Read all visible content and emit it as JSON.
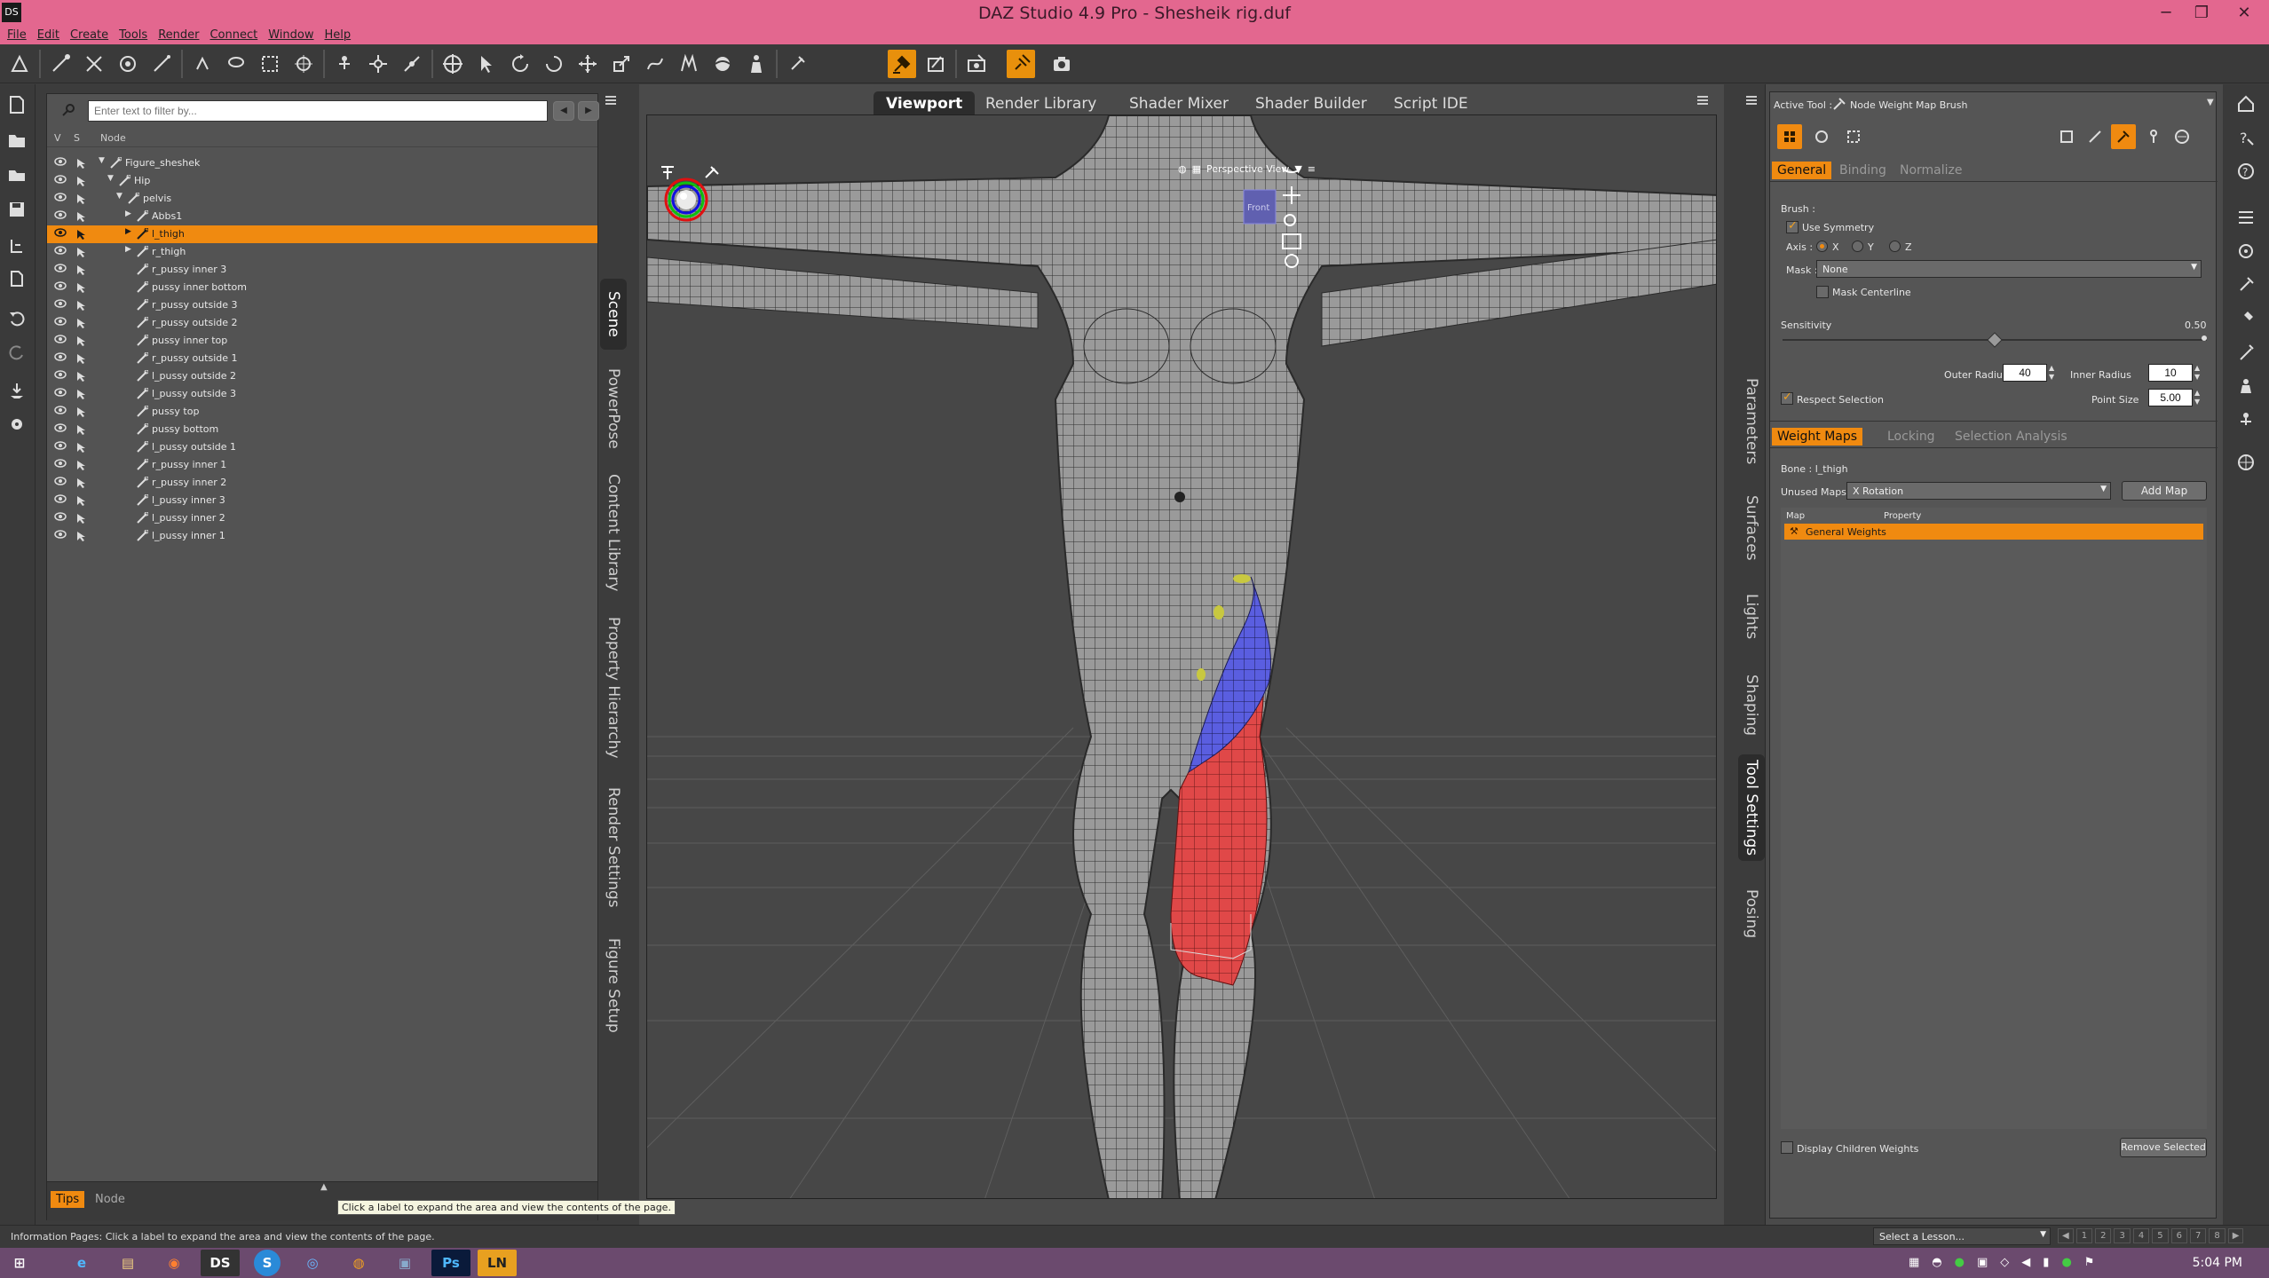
{
  "window": {
    "title": "DAZ Studio 4.9 Pro - Shesheik rig.duf",
    "app_icon": "DS",
    "min": "─",
    "max": "❐",
    "close": "✕"
  },
  "menu": [
    "File",
    "Edit",
    "Create",
    "Tools",
    "Render",
    "Connect",
    "Window",
    "Help"
  ],
  "scene": {
    "filter_placeholder": "Enter text to filter by...",
    "columns": {
      "v": "V",
      "s": "S",
      "node": "Node"
    },
    "nodes": [
      {
        "label": "Figure_sheshek",
        "indent": 0,
        "expanded": true,
        "type": "figure"
      },
      {
        "label": "Hip",
        "indent": 1,
        "expanded": true,
        "type": "bone"
      },
      {
        "label": "pelvis",
        "indent": 2,
        "expanded": true,
        "type": "bone"
      },
      {
        "label": "Abbs1",
        "indent": 3,
        "expanded": false,
        "type": "bone"
      },
      {
        "label": "l_thigh",
        "indent": 3,
        "expanded": false,
        "type": "bone",
        "selected": true
      },
      {
        "label": "r_thigh",
        "indent": 3,
        "expanded": false,
        "type": "bone"
      },
      {
        "label": "r_pussy inner 3",
        "indent": 3,
        "type": "bone"
      },
      {
        "label": "pussy  inner bottom",
        "indent": 3,
        "type": "bone"
      },
      {
        "label": "r_pussy  outside 3",
        "indent": 3,
        "type": "bone"
      },
      {
        "label": "r_pussy  outside 2",
        "indent": 3,
        "type": "bone"
      },
      {
        "label": "pussy  inner top",
        "indent": 3,
        "type": "bone"
      },
      {
        "label": "r_pussy  outside 1",
        "indent": 3,
        "type": "bone"
      },
      {
        "label": "l_pussy  outside 2",
        "indent": 3,
        "type": "bone"
      },
      {
        "label": "l_pussy  outside 3",
        "indent": 3,
        "type": "bone"
      },
      {
        "label": "pussy top",
        "indent": 3,
        "type": "bone"
      },
      {
        "label": "pussy bottom",
        "indent": 3,
        "type": "bone"
      },
      {
        "label": "l_pussy  outside 1",
        "indent": 3,
        "type": "bone"
      },
      {
        "label": "r_pussy inner 1",
        "indent": 3,
        "type": "bone"
      },
      {
        "label": "r_pussy inner 2",
        "indent": 3,
        "type": "bone"
      },
      {
        "label": "l_pussy inner 3",
        "indent": 3,
        "type": "bone"
      },
      {
        "label": "l_pussy inner 2",
        "indent": 3,
        "type": "bone"
      },
      {
        "label": "l_pussy inner 1",
        "indent": 3,
        "type": "bone"
      }
    ],
    "bottom_tabs": [
      "Tips",
      "Node"
    ]
  },
  "left_side_tabs": [
    "Scene",
    "PowerPose",
    "Content Library",
    "Property Hierarchy",
    "Render Settings",
    "Figure Setup"
  ],
  "viewport": {
    "tabs": [
      "Viewport",
      "Render Library",
      "Shader Mixer",
      "Shader Builder",
      "Script IDE"
    ],
    "active_tab": "Viewport",
    "camera": "Perspective View",
    "cube_label": "Front",
    "tooltip": "Click a label to expand the area and view the contents of the page."
  },
  "right_side_tabs": [
    "Parameters",
    "Surfaces",
    "Lights",
    "Shaping",
    "Tool Settings",
    "Posing"
  ],
  "tool_settings": {
    "active_tool_label": "Active Tool :",
    "active_tool": "Node Weight Map Brush",
    "tabs": [
      "General",
      "Binding",
      "Normalize"
    ],
    "brush_label": "Brush :",
    "use_symmetry": "Use Symmetry",
    "axis_label": "Axis :",
    "axes": [
      "X",
      "Y",
      "Z"
    ],
    "mask_label": "Mask :",
    "mask_value": "None",
    "mask_centerline": "Mask Centerline",
    "sensitivity_label": "Sensitivity",
    "sensitivity_value": "0.50",
    "sensitivity": 0.5,
    "outer_radius_label": "Outer Radius",
    "outer_radius": "40",
    "inner_radius_label": "Inner Radius",
    "inner_radius": "10",
    "respect_selection": "Respect Selection",
    "point_size_label": "Point Size",
    "point_size": "5.00",
    "map_tabs": [
      "Weight Maps",
      "Locking",
      "Selection Analysis"
    ],
    "bone_label": "Bone : l_thigh",
    "unused_maps_label": "Unused Maps :",
    "unused_maps_value": "X Rotation",
    "add_map": "Add Map",
    "map_col": "Map",
    "property_col": "Property",
    "map_row": "General Weights",
    "display_children": "Display Children Weights",
    "remove_selected": "Remove Selected"
  },
  "statusbar": {
    "info": "Information Pages: Click a label to expand the area and view the contents of the page.",
    "lesson": "Select a Lesson...",
    "steps": [
      "1",
      "2",
      "3",
      "4",
      "5",
      "6",
      "7",
      "8"
    ]
  },
  "taskbar": {
    "clock": "5:04 PM",
    "apps": [
      "⊞",
      "e",
      "▤",
      "◉",
      "DS",
      "S",
      "◎",
      "◍",
      "▣",
      "Ps",
      "LN"
    ]
  }
}
